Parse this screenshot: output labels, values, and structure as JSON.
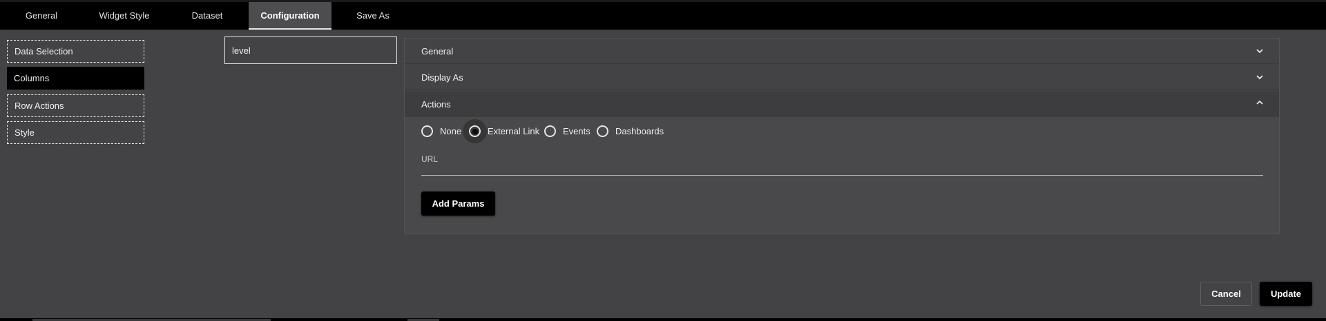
{
  "tabs": [
    {
      "label": "General"
    },
    {
      "label": "Widget Style"
    },
    {
      "label": "Dataset"
    },
    {
      "label": "Configuration"
    },
    {
      "label": "Save As"
    }
  ],
  "sidebar": {
    "items": [
      {
        "label": "Data Selection"
      },
      {
        "label": "Columns"
      },
      {
        "label": "Row Actions"
      },
      {
        "label": "Style"
      }
    ]
  },
  "column_search": {
    "value": "level"
  },
  "accordion": {
    "sections": [
      {
        "title": "General",
        "state": "collapsed",
        "icon": "chevron-down-icon"
      },
      {
        "title": "Display As",
        "state": "collapsed",
        "icon": "chevron-down-icon"
      },
      {
        "title": "Actions",
        "state": "expanded",
        "icon": "chevron-up-icon"
      }
    ]
  },
  "actions": {
    "options": [
      {
        "label": "None",
        "selected": false
      },
      {
        "label": "External Link",
        "selected": true
      },
      {
        "label": "Events",
        "selected": false
      },
      {
        "label": "Dashboards",
        "selected": false
      }
    ],
    "url_label": "URL",
    "url_value": "",
    "add_params_label": "Add Params"
  },
  "footer": {
    "cancel_label": "Cancel",
    "update_label": "Update"
  }
}
